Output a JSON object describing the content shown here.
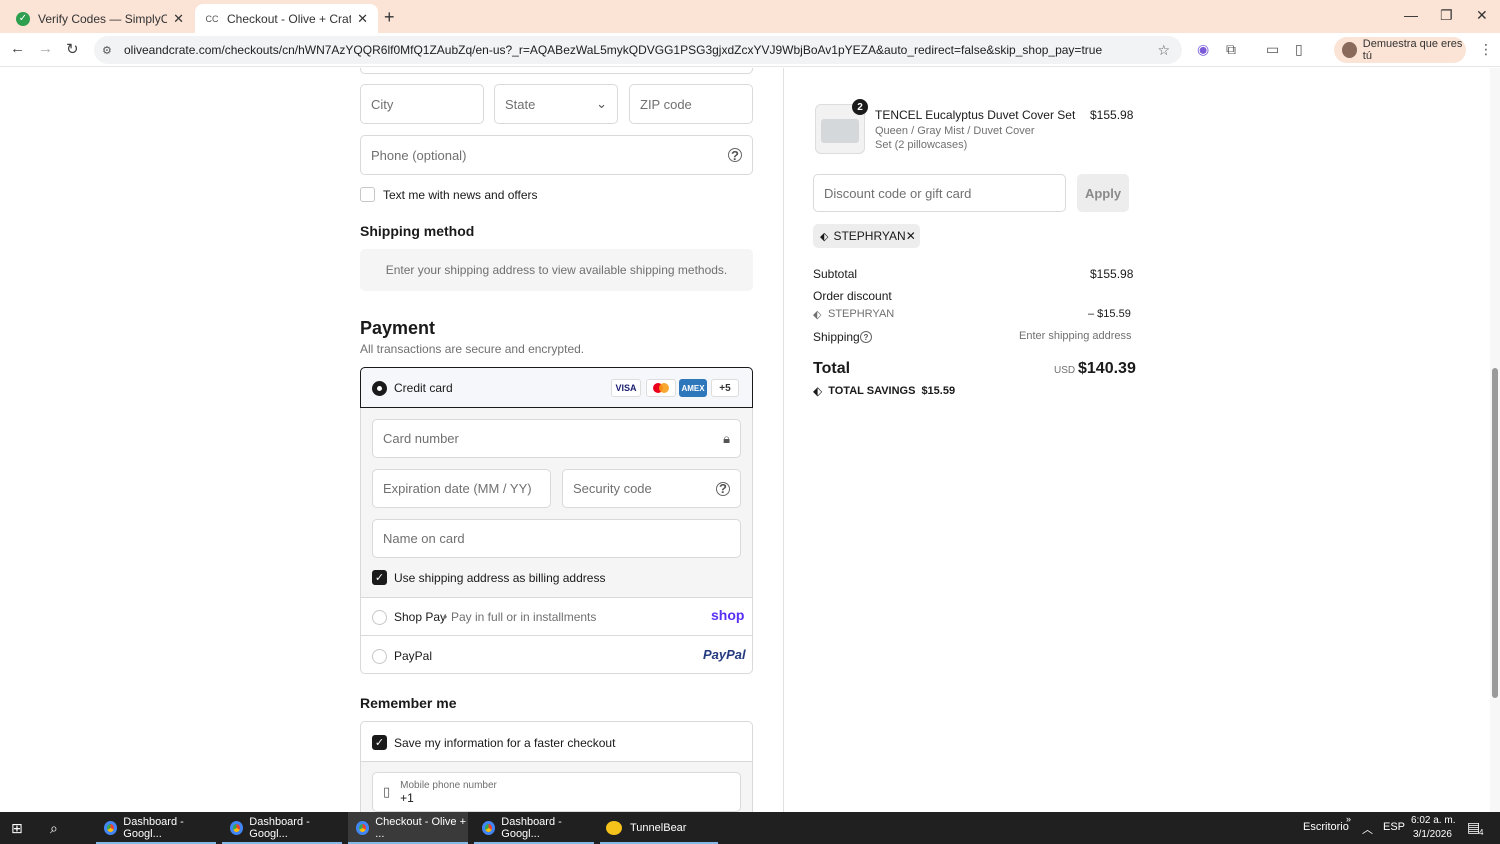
{
  "browser": {
    "tabs": [
      {
        "title": "Verify Codes — SimplyCodes",
        "icon": "simplycodes-icon"
      },
      {
        "title": "Checkout - Olive + Crate",
        "icon": "oliveandcrate-icon"
      }
    ],
    "url": "oliveandcrate.com/checkouts/cn/hWN7AzYQQR6lf0MfQ1ZAubZq/en-us?_r=AQABezWaL5mykQDVGG1PSG3gjxdZcxYVJ9WbjBoAv1pYEZA&auto_redirect=false&skip_shop_pay=true",
    "profile_label": "Demuestra que eres tú"
  },
  "form": {
    "city_placeholder": "City",
    "state_placeholder": "State",
    "zip_placeholder": "ZIP code",
    "phone_placeholder": "Phone (optional)",
    "text_me_label": "Text me with news and offers",
    "text_me_checked": false
  },
  "shipping": {
    "heading": "Shipping method",
    "notice": "Enter your shipping address to view available shipping methods."
  },
  "payment": {
    "heading": "Payment",
    "subheading": "All transactions are secure and encrypted.",
    "credit_card_label": "Credit card",
    "card_logos": [
      "VISA",
      "mastercard",
      "AMEX"
    ],
    "more_cards": "+5",
    "card_number_placeholder": "Card number",
    "expiry_placeholder": "Expiration date (MM / YY)",
    "security_placeholder": "Security code",
    "name_placeholder": "Name on card",
    "billing_same_label": "Use shipping address as billing address",
    "billing_same_checked": true,
    "shop_pay_label": "Shop Pay",
    "shop_pay_sub": "Pay in full or in installments",
    "shop_pay_logo": "shop",
    "paypal_label": "PayPal",
    "paypal_logo": "PayPal"
  },
  "remember": {
    "heading": "Remember me",
    "save_label": "Save my information for a faster checkout",
    "save_checked": true,
    "mobile_label": "Mobile phone number",
    "mobile_prefix": "+1"
  },
  "summary": {
    "item_qty": "2",
    "item_name": "TENCEL Eucalyptus Duvet Cover Set",
    "item_variant": "Queen / Gray Mist / Duvet Cover Set (2 pillowcases)",
    "item_price": "$155.98",
    "discount_placeholder": "Discount code or gift card",
    "apply_label": "Apply",
    "applied_code": "STEPHRYAN",
    "subtotal_label": "Subtotal",
    "subtotal_value": "$155.98",
    "order_discount_label": "Order discount",
    "discount_code": "STEPHRYAN",
    "discount_value": "– $15.59",
    "shipping_label": "Shipping",
    "shipping_value": "Enter shipping address",
    "total_label": "Total",
    "currency": "USD",
    "total_value": "$140.39",
    "savings_label": "TOTAL SAVINGS",
    "savings_value": "$15.59"
  },
  "taskbar": {
    "items": [
      {
        "label": "Dashboard - Googl..."
      },
      {
        "label": "Dashboard - Googl..."
      },
      {
        "label": "Checkout - Olive + ..."
      },
      {
        "label": "Dashboard - Googl..."
      },
      {
        "label": "TunnelBear"
      }
    ],
    "desktop_label": "Escritorio",
    "lang": "ESP",
    "time": "6:02 a. m.",
    "date": "3/1/2026",
    "notif_count": "4"
  }
}
